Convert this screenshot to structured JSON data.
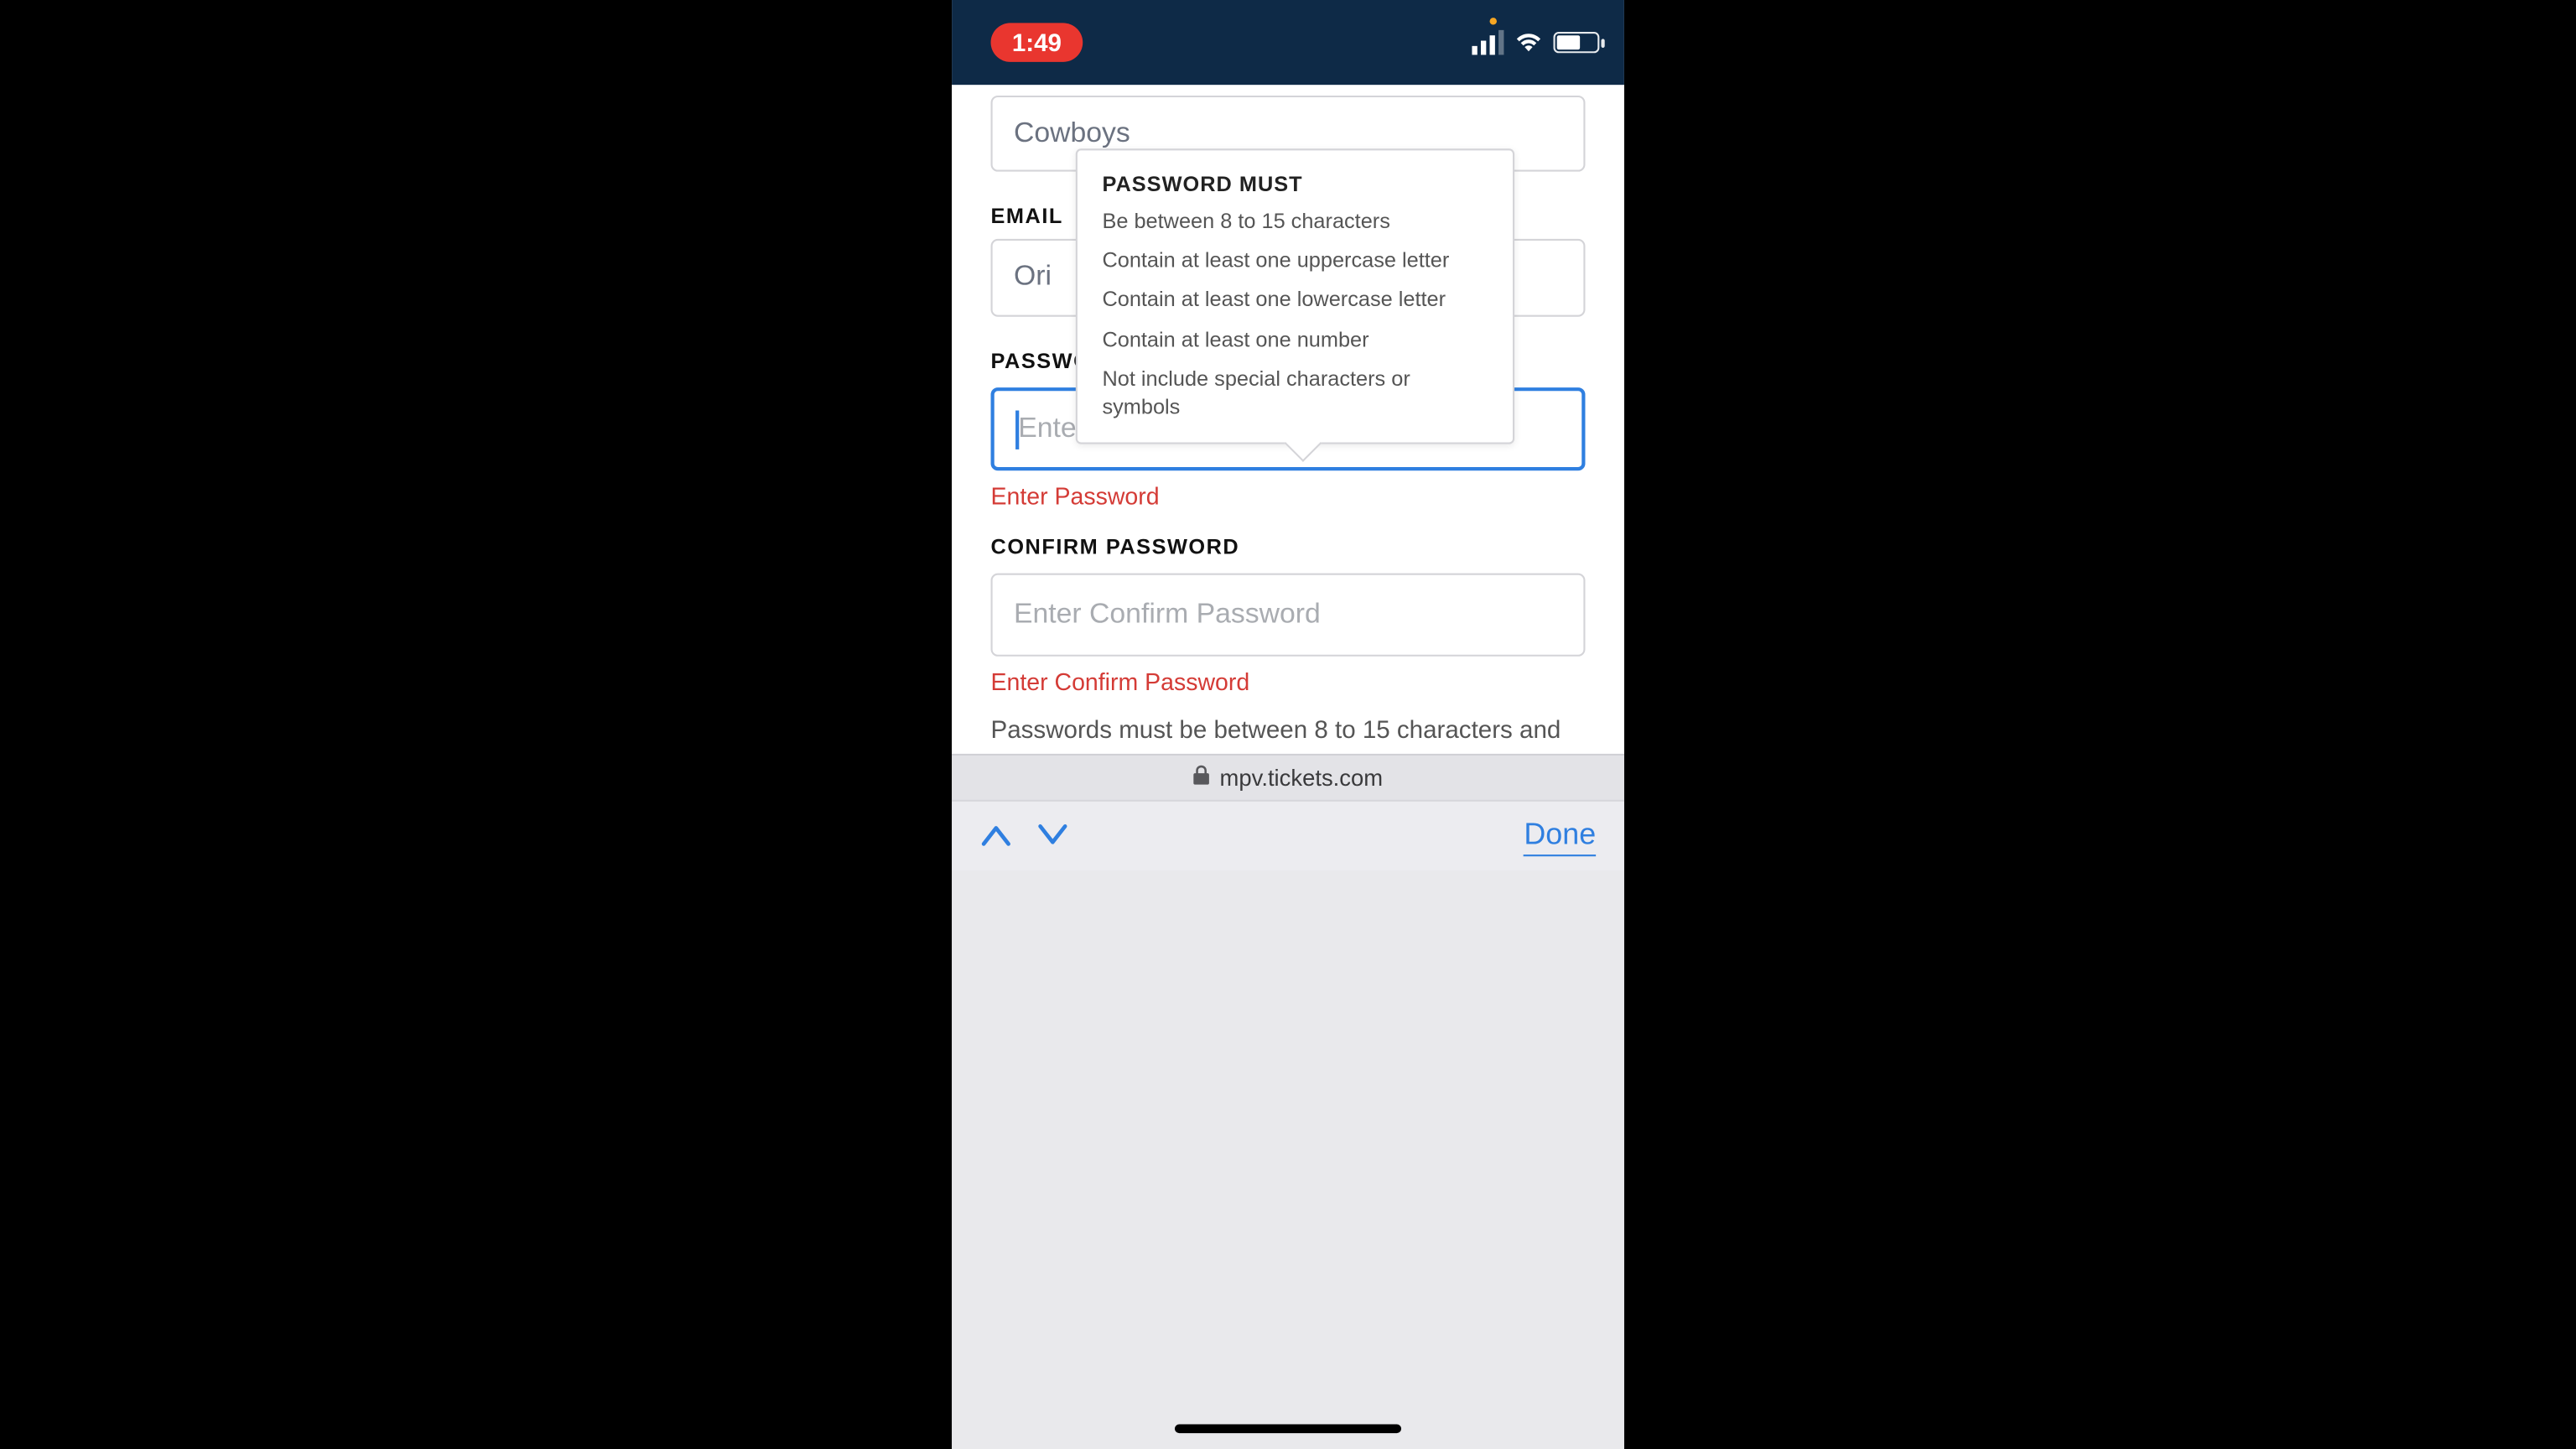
{
  "statusbar": {
    "time": "1:49"
  },
  "form": {
    "prev_field_value": "Cowboys",
    "email_label": "EMAIL",
    "email_value_prefix": "Ori",
    "password_label": "PASSWORD",
    "password_placeholder": "Enter Password",
    "password_error": "Enter Password",
    "confirm_label": "CONFIRM PASSWORD",
    "confirm_placeholder": "Enter Confirm Password",
    "confirm_error": "Enter Confirm Password",
    "help_text": "Passwords must be between 8 to 15 characters and"
  },
  "tooltip": {
    "title": "PASSWORD MUST",
    "reqs": [
      "Be between 8 to 15 characters",
      "Contain at least one uppercase letter",
      "Contain at least one lowercase letter",
      "Contain at least one number",
      "Not include special characters or symbols"
    ]
  },
  "urlbar": {
    "host": "mpv.tickets.com"
  },
  "accessory": {
    "done": "Done"
  }
}
